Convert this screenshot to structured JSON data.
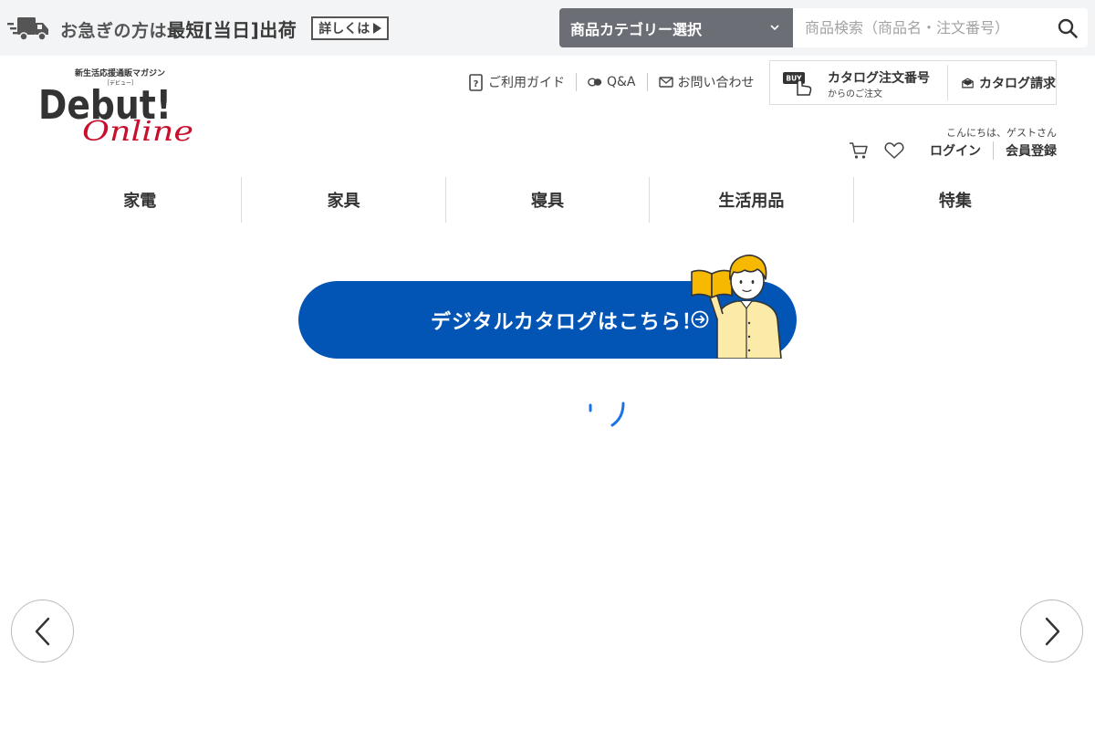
{
  "promo": {
    "text": "お急ぎの方は",
    "strong": "最短[当日]出荷",
    "more_label": "詳しくは"
  },
  "search": {
    "category_label": "商品カテゴリー選択",
    "placeholder": "商品検索（商品名・注文番号）"
  },
  "logo": {
    "tagline": "新生活応援通販マガジン",
    "reading": "［デビュー］",
    "name": "Debut! Online"
  },
  "util_links": [
    {
      "label": "ご利用ガイド",
      "icon": "guide-icon"
    },
    {
      "label": "Q&A",
      "icon": "qa-icon"
    },
    {
      "label": "お問い合わせ",
      "icon": "mail-icon"
    }
  ],
  "catalog": {
    "order_title": "カタログ注文番号",
    "order_sub": "からのご注文",
    "order_icon": "buy-hand-icon",
    "order_badge": "BUY",
    "request_label": "カタログ請求",
    "request_icon": "catalog-request-icon"
  },
  "user": {
    "greeting": "こんにちは、ゲストさん",
    "login_label": "ログイン",
    "register_label": "会員登録",
    "cart_icon": "cart-icon",
    "favorite_icon": "heart-icon"
  },
  "nav": {
    "items": [
      "家電",
      "家具",
      "寝具",
      "生活用品",
      "特集"
    ]
  },
  "banner": {
    "label": "デジタルカタログはこちら！"
  },
  "colors": {
    "topbar_bg": "#f3f4f6",
    "category_bg": "#6b6f75",
    "banner_bg": "#0255b5",
    "logo_red": "#c8102e",
    "spinner": "#1a73e8"
  }
}
